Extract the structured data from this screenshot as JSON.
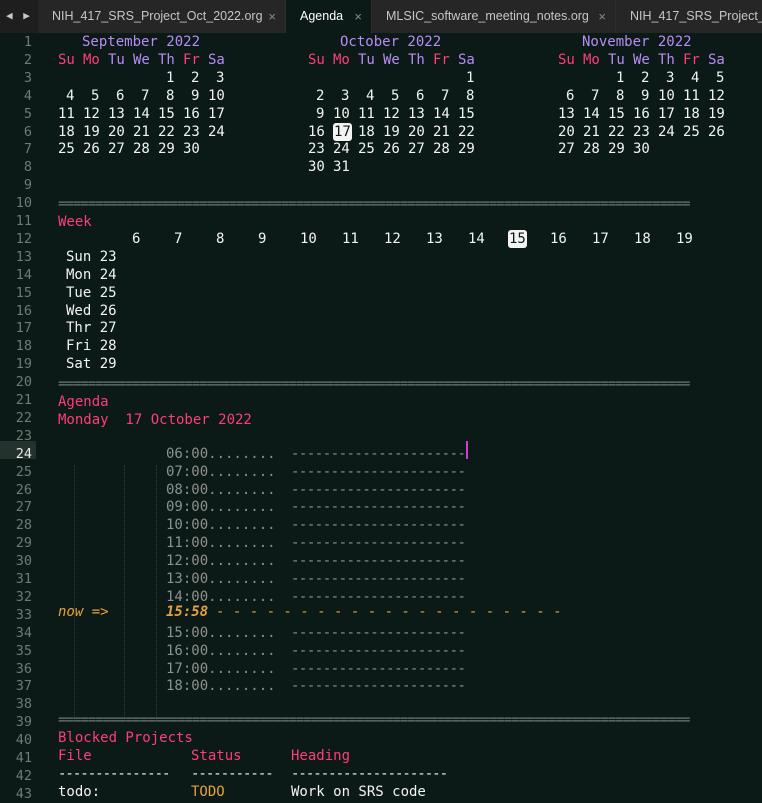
{
  "tabs": [
    {
      "label": "NIH_417_SRS_Project_Oct_2022.org",
      "active": false
    },
    {
      "label": "Agenda",
      "active": true
    },
    {
      "label": "MLSIC_software_meeting_notes.org",
      "active": false
    },
    {
      "label": "NIH_417_SRS_Project_O",
      "active": false
    }
  ],
  "close_glyph": "×",
  "nav_arrows": "◀ ▶",
  "line_numbers": [
    "1",
    "2",
    "3",
    "4",
    "5",
    "6",
    "7",
    "8",
    "9",
    "10",
    "11",
    "12",
    "13",
    "14",
    "15",
    "16",
    "17",
    "18",
    "19",
    "20",
    "21",
    "22",
    "23",
    "24",
    "25",
    "26",
    "27",
    "28",
    "29",
    "30",
    "31",
    "32",
    "33",
    "34",
    "35",
    "36",
    "37",
    "38",
    "39",
    "40",
    "41",
    "42",
    "43"
  ],
  "current_line": "24",
  "calendar": {
    "day_headers": [
      "Su",
      "Mo",
      "Tu",
      "We",
      "Th",
      "Fr",
      "Sa"
    ],
    "months": [
      {
        "title": "September 2022",
        "weeks": [
          "            1  2  3",
          " 4  5  6  7  8  9 10",
          "11 12 13 14 15 16 17",
          "18 19 20 21 22 23 24",
          "25 26 27 28 29 30"
        ]
      },
      {
        "title": "October 2022",
        "weeks": [
          "                   1",
          " 2  3  4  5  6  7  8",
          " 9 10 11 12 13 14 15",
          "16 17 18 19 20 21 22",
          "23 24 25 26 27 28 29",
          "30 31"
        ],
        "today": "17"
      },
      {
        "title": "November 2022",
        "weeks": [
          "       1  2  3  4  5",
          " 6  7  8  9 10 11 12",
          "13 14 15 16 17 18 19",
          "20 21 22 23 24 25 26",
          "27 28 29 30"
        ]
      }
    ]
  },
  "rule": "=====================================================================================",
  "week": {
    "heading": "Week",
    "hours": [
      "6",
      "7",
      "8",
      "9",
      "10",
      "11",
      "12",
      "13",
      "14",
      "15",
      "16",
      "17",
      "18",
      "19"
    ],
    "current_hour": "15",
    "days": [
      "Sun 23",
      "Mon 24",
      "Tue 25",
      "Wed 26",
      "Thr 27",
      "Fri 28",
      "Sat 29"
    ]
  },
  "agenda": {
    "heading": "Agenda",
    "date_line": "Monday  17 October 2022",
    "time_grid_before": [
      "06:00........",
      "07:00........",
      "08:00........",
      "09:00........",
      "10:00........",
      "11:00........",
      "12:00........",
      "13:00........",
      "14:00........"
    ],
    "time_grid_after": [
      "15:00........",
      "16:00........",
      "17:00........",
      "18:00........"
    ],
    "grid_rule": "----------------------",
    "now_label": "now =>",
    "now_time": "15:58",
    "now_dashes": "- - - - - - - - - - - - - - - - - - - - -"
  },
  "blocked": {
    "heading": "Blocked Projects",
    "columns": [
      "File",
      "Status",
      "Heading"
    ],
    "col_rules": [
      "---------------",
      "-----------",
      "---------------------"
    ],
    "rows": [
      {
        "file": "todo:",
        "status": "TODO",
        "heading": "Work on SRS code"
      }
    ]
  },
  "colors": {
    "background": "#0b1a16",
    "month_title": "#b98bf5",
    "heading_pink": "#ff3d7a",
    "now_orange": "#e8a23a",
    "caret": "#d23bd8"
  }
}
